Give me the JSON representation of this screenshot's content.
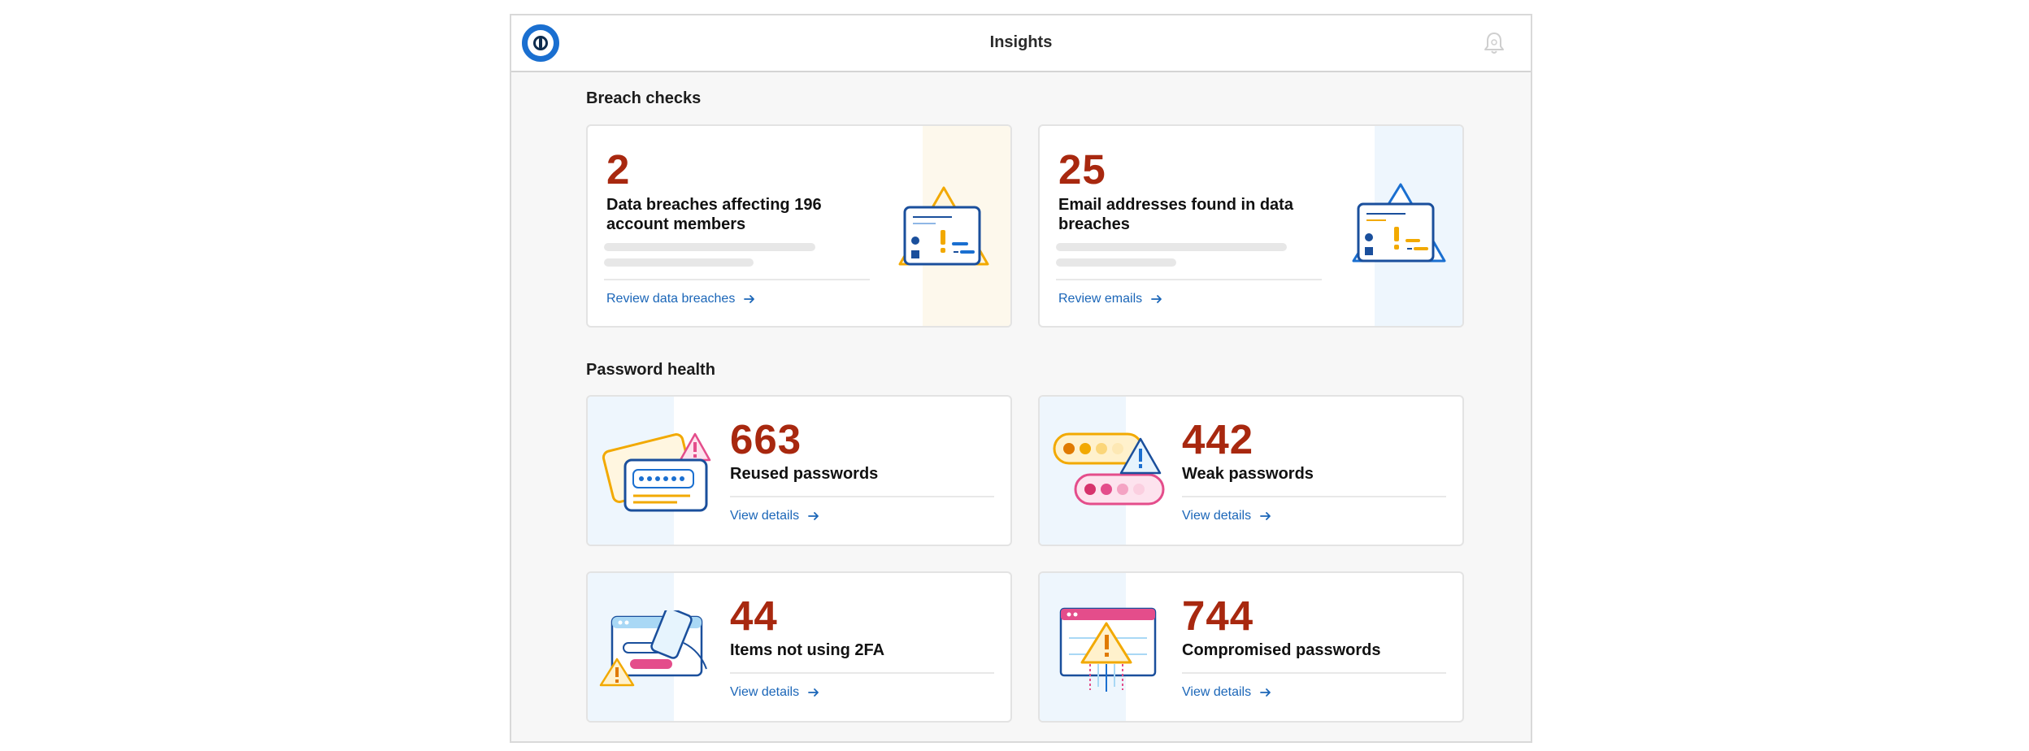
{
  "header": {
    "title": "Insights"
  },
  "breach": {
    "section_title": "Breach checks",
    "cards": [
      {
        "number": "2",
        "label": "Data breaches affecting 196 account members",
        "link": "Review data breaches"
      },
      {
        "number": "25",
        "label": "Email addresses found in data breaches",
        "link": "Review emails"
      }
    ]
  },
  "health": {
    "section_title": "Password health",
    "cards": [
      {
        "number": "663",
        "label": "Reused passwords",
        "link": "View details"
      },
      {
        "number": "442",
        "label": "Weak passwords",
        "link": "View details"
      },
      {
        "number": "44",
        "label": "Items not using 2FA",
        "link": "View details"
      },
      {
        "number": "744",
        "label": "Compromised passwords",
        "link": "View details"
      }
    ]
  },
  "icons": {
    "logo": "1password-logo",
    "bell": "bell-icon",
    "arrow": "arrow-right-icon"
  },
  "colors": {
    "number_red": "#a8280f",
    "link_blue": "#1b66b8",
    "band_yellow": "#fdf8ec",
    "band_blue": "#eef6fd"
  }
}
